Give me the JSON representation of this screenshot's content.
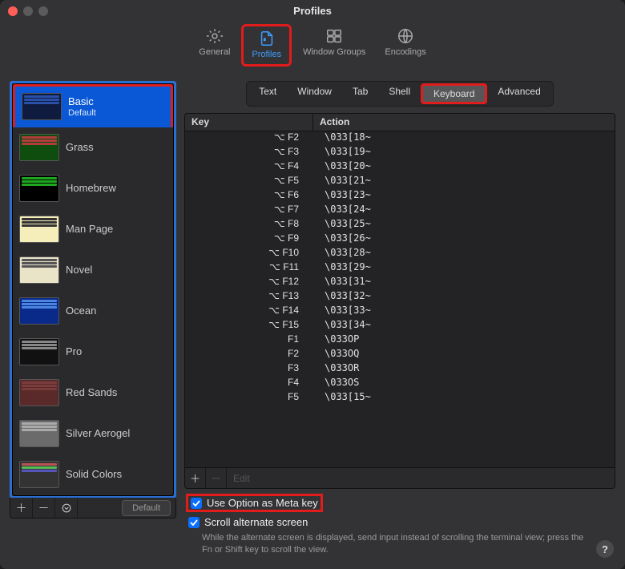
{
  "window": {
    "title": "Profiles"
  },
  "traffic_colors": {
    "close": "#ff5f57",
    "min": "#5b5b5b",
    "max": "#5b5b5b"
  },
  "toptabs": {
    "items": [
      {
        "id": "general",
        "label": "General"
      },
      {
        "id": "profiles",
        "label": "Profiles"
      },
      {
        "id": "window-groups",
        "label": "Window Groups"
      },
      {
        "id": "encodings",
        "label": "Encodings"
      }
    ],
    "active": "profiles"
  },
  "sidebar": {
    "items": [
      {
        "label": "Basic",
        "sublabel": "Default",
        "selected": true,
        "colors": [
          "#2a4fa8",
          "#2a4fa8",
          "#2a4fa8"
        ],
        "bg": "#0f1b3f"
      },
      {
        "label": "Grass",
        "colors": [
          "#b33c3c",
          "#b33c3c",
          "#b33c3c"
        ],
        "bg": "#0f4d0f"
      },
      {
        "label": "Homebrew",
        "colors": [
          "#1fa81f",
          "#1fa81f",
          "#1fa81f"
        ],
        "bg": "#000"
      },
      {
        "label": "Man Page",
        "colors": [
          "#333",
          "#333",
          "#333"
        ],
        "bg": "#f5eebb"
      },
      {
        "label": "Novel",
        "colors": [
          "#555",
          "#555",
          "#555"
        ],
        "bg": "#e9e3c8"
      },
      {
        "label": "Ocean",
        "colors": [
          "#4a85e0",
          "#4a85e0",
          "#4a85e0"
        ],
        "bg": "#0a2a8a"
      },
      {
        "label": "Pro",
        "colors": [
          "#888",
          "#888",
          "#888"
        ],
        "bg": "#111"
      },
      {
        "label": "Red Sands",
        "colors": [
          "#7a3c3c",
          "#7a3c3c",
          "#7a3c3c"
        ],
        "bg": "#5a2a2a"
      },
      {
        "label": "Silver Aerogel",
        "colors": [
          "#aaa",
          "#aaa",
          "#aaa"
        ],
        "bg": "#6b6b6b"
      },
      {
        "label": "Solid Colors",
        "colors": [
          "#b55",
          "#5b5",
          "#55b"
        ],
        "bg": "#333"
      }
    ],
    "footer": {
      "default_label": "Default"
    }
  },
  "segments": {
    "items": [
      {
        "id": "text",
        "label": "Text"
      },
      {
        "id": "window",
        "label": "Window"
      },
      {
        "id": "tab",
        "label": "Tab"
      },
      {
        "id": "shell",
        "label": "Shell"
      },
      {
        "id": "keyboard",
        "label": "Keyboard"
      },
      {
        "id": "advanced",
        "label": "Advanced"
      }
    ],
    "active": "keyboard"
  },
  "table": {
    "headers": {
      "key": "Key",
      "action": "Action"
    },
    "rows": [
      {
        "key": "⌥ F2",
        "action": "\\033[18~"
      },
      {
        "key": "⌥ F3",
        "action": "\\033[19~"
      },
      {
        "key": "⌥ F4",
        "action": "\\033[20~"
      },
      {
        "key": "⌥ F5",
        "action": "\\033[21~"
      },
      {
        "key": "⌥ F6",
        "action": "\\033[23~"
      },
      {
        "key": "⌥ F7",
        "action": "\\033[24~"
      },
      {
        "key": "⌥ F8",
        "action": "\\033[25~"
      },
      {
        "key": "⌥ F9",
        "action": "\\033[26~"
      },
      {
        "key": "⌥ F10",
        "action": "\\033[28~"
      },
      {
        "key": "⌥ F11",
        "action": "\\033[29~"
      },
      {
        "key": "⌥ F12",
        "action": "\\033[31~"
      },
      {
        "key": "⌥ F13",
        "action": "\\033[32~"
      },
      {
        "key": "⌥ F14",
        "action": "\\033[33~"
      },
      {
        "key": "⌥ F15",
        "action": "\\033[34~"
      },
      {
        "key": "F1",
        "action": "\\033OP"
      },
      {
        "key": "F2",
        "action": "\\033OQ"
      },
      {
        "key": "F3",
        "action": "\\033OR"
      },
      {
        "key": "F4",
        "action": "\\033OS"
      },
      {
        "key": "F5",
        "action": "\\033[15~"
      }
    ],
    "footer": {
      "edit_label": "Edit"
    }
  },
  "checks": {
    "option_meta": {
      "label": "Use Option as Meta key",
      "checked": true
    },
    "scroll_alt": {
      "label": "Scroll alternate screen",
      "checked": true
    },
    "hint": "While the alternate screen is displayed, send input instead of scrolling the terminal view; press the Fn or Shift key to scroll the view."
  }
}
